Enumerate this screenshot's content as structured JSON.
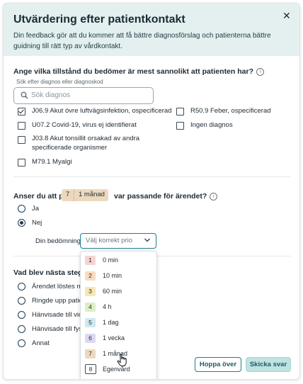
{
  "dialog": {
    "title": "Utvärdering efter patientkontakt",
    "subtitle": "Din feedback gör att du kommer att få bättre diagnosförslag och patienterna bättre guidning till rätt typ av vårdkontakt.",
    "close_icon": "close-icon"
  },
  "q1": {
    "question": "Ange vilka tillstånd du bedömer är mest sannolikt att patienten har?",
    "info_icon": "ⓘ",
    "search_label": "Sök efter diagnos eller diagnoskod",
    "search_placeholder": "Sök diagnos",
    "search_icon": "search-icon",
    "options": [
      {
        "label": "J06.9 Akut övre luftvägsinfektion, ospecificerad",
        "checked": true
      },
      {
        "label": "U07.2 Covid-19, virus ej identifierat",
        "checked": false
      },
      {
        "label": "J03.8 Akut tonsillit orsakad av andra specificerade organismer",
        "checked": false
      },
      {
        "label": "M79.1 Myalgi",
        "checked": false
      },
      {
        "label": "R50.9 Feber, ospecificerad",
        "checked": false
      },
      {
        "label": "Ingen diagnos",
        "checked": false
      }
    ]
  },
  "q2": {
    "question_prefix": "Anser du att prio",
    "prio_number": "7",
    "prio_label": "1 månad",
    "question_suffix": "var passande för ärendet?",
    "info_icon": "ⓘ",
    "yes": "Ja",
    "no": "Nej",
    "selected": "Nej",
    "assessment_label": "Din bedömning:",
    "select_placeholder": "Välj korrekt prio",
    "dropdown_options": [
      {
        "num": "1",
        "label": "0 min",
        "color": "#f6d3d3"
      },
      {
        "num": "2",
        "label": "10 min",
        "color": "#f7dcc1"
      },
      {
        "num": "3",
        "label": "60 min",
        "color": "#f5e7b5"
      },
      {
        "num": "4",
        "label": "4 h",
        "color": "#dcefc6"
      },
      {
        "num": "5",
        "label": "1 dag",
        "color": "#cde9ef"
      },
      {
        "num": "6",
        "label": "1 vecka",
        "color": "#dcd8f2"
      },
      {
        "num": "7",
        "label": "1 månad",
        "color": "#ecd9bd"
      },
      {
        "num": "8",
        "label": "Egenvård",
        "color": "#ffffff"
      }
    ]
  },
  "q3": {
    "question": "Vad blev nästa steg i kon",
    "options": [
      "Ärendet löstes me",
      "Ringde upp patien",
      "Hänvisade till vid",
      "Hänvisade till fysi",
      "Annat"
    ]
  },
  "footer": {
    "skip_label": "Hoppa över",
    "send_label": "Skicka svar"
  },
  "colors": {
    "header_bg": "#e3f0ef",
    "accent": "#1d7f8c",
    "prio_chip": "#ecd9bd"
  }
}
